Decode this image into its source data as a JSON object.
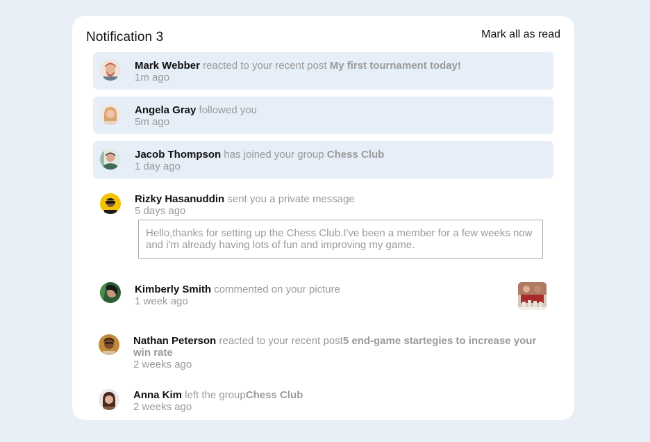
{
  "header": {
    "title": "Notification 3",
    "mark_all": "Mark all as read"
  },
  "notifications": [
    {
      "name": "Mark Webber",
      "action": " reacted to your recent post ",
      "target": "My first tournament today!",
      "time": "1m ago",
      "unread": true,
      "avatar_color": "#c65a3a"
    },
    {
      "name": "Angela Gray",
      "action": " followed you",
      "target": "",
      "time": "5m ago",
      "unread": true,
      "avatar_color": "#d9a38a"
    },
    {
      "name": "Jacob Thompson",
      "action": " has joined your group ",
      "target": "Chess Club",
      "time": "1 day ago",
      "unread": true,
      "avatar_color": "#3f6b54"
    },
    {
      "name": "Rizky Hasanuddin",
      "action": " sent you a private message",
      "target": "",
      "time": "5 days ago",
      "unread": false,
      "avatar_color": "#e5b600",
      "message": "Hello,thanks for setting up the Chess Club.I've been a member for a few weeks now and i'm already having lots of fun and improving my game."
    },
    {
      "name": "Kimberly Smith",
      "action": " commented on your picture",
      "target": "",
      "time": "1 week ago",
      "unread": false,
      "avatar_color": "#2e6b3a"
    },
    {
      "name": "Nathan Peterson",
      "action": " reacted to your recent post",
      "target": "5 end-game startegies to increase your win rate",
      "time": "2 weeks ago",
      "unread": false,
      "avatar_color": "#a06a2a"
    },
    {
      "name": "Anna Kim",
      "action": " left the group",
      "target": "Chess Club",
      "time": "2 weeks ago",
      "unread": false,
      "avatar_color": "#8a5a48"
    }
  ]
}
